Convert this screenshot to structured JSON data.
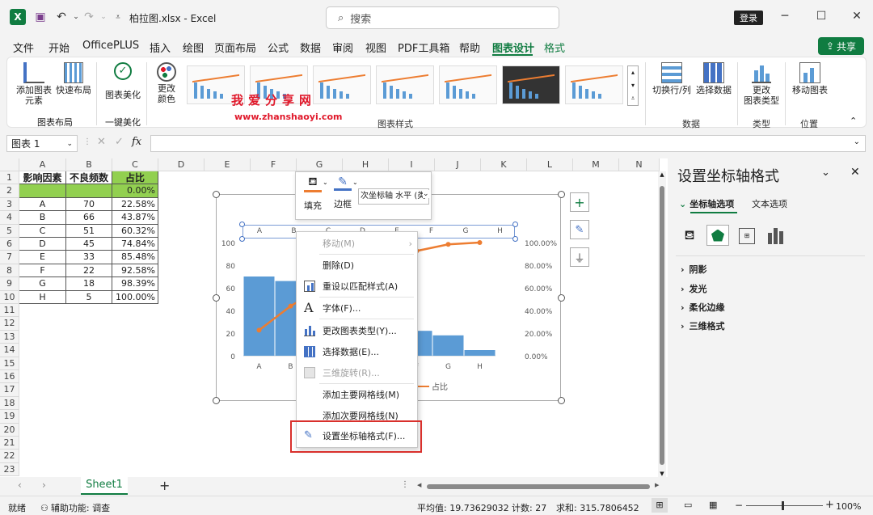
{
  "titlebar": {
    "filename": "柏拉图.xlsx",
    "app": "Excel",
    "search_placeholder": "搜索",
    "login": "登录"
  },
  "menu": {
    "tabs": [
      "文件",
      "开始",
      "OfficePLUS",
      "插入",
      "绘图",
      "页面布局",
      "公式",
      "数据",
      "审阅",
      "视图",
      "PDF工具箱",
      "帮助",
      "图表设计",
      "格式"
    ],
    "active": "图表设计",
    "share": "共享"
  },
  "ribbon": {
    "add_element": "添加图表\n元素",
    "quick_layout": "快速布局",
    "beautify": "图表美化",
    "change_color": "更改\n颜色",
    "group_layout": "图表布局",
    "group_onekey": "一键美化",
    "group_styles": "图表样式",
    "switch_rowcol": "切换行/列",
    "select_data": "选择数据",
    "group_data": "数据",
    "change_type": "更改\n图表类型",
    "group_type": "类型",
    "move_chart": "移动图表",
    "group_position": "位置",
    "watermark1": "我爱分享网",
    "watermark2": "www.zhanshaoyi.com"
  },
  "formula": {
    "namebox": "图表 1",
    "fx": "fx"
  },
  "columns": [
    "A",
    "B",
    "C",
    "D",
    "E",
    "F",
    "G",
    "H",
    "I",
    "J",
    "K",
    "L",
    "M",
    "N"
  ],
  "rows": [
    "1",
    "2",
    "3",
    "4",
    "5",
    "6",
    "7",
    "8",
    "9",
    "10",
    "11",
    "12",
    "13",
    "14",
    "15",
    "16",
    "17",
    "18",
    "19",
    "20",
    "21",
    "22",
    "23"
  ],
  "table": {
    "headers": [
      "影响因素",
      "不良频数",
      "占比"
    ],
    "row2": [
      "",
      "",
      "0.00%"
    ],
    "data": [
      [
        "A",
        "70",
        "22.58%"
      ],
      [
        "B",
        "66",
        "43.87%"
      ],
      [
        "C",
        "51",
        "60.32%"
      ],
      [
        "D",
        "45",
        "74.84%"
      ],
      [
        "E",
        "33",
        "85.48%"
      ],
      [
        "F",
        "22",
        "92.58%"
      ],
      [
        "G",
        "18",
        "98.39%"
      ],
      [
        "H",
        "5",
        "100.00%"
      ]
    ]
  },
  "chart": {
    "y_ticks": [
      "100",
      "80",
      "60",
      "40",
      "20",
      "0"
    ],
    "y2_ticks": [
      "100.00%",
      "80.00%",
      "60.00%",
      "40.00%",
      "20.00%",
      "0.00%"
    ],
    "x_ticks": [
      "A",
      "B",
      "C",
      "D",
      "E",
      "F",
      "G",
      "H"
    ],
    "legend": "占比"
  },
  "chart_data": {
    "type": "bar",
    "categories": [
      "A",
      "B",
      "C",
      "D",
      "E",
      "F",
      "G",
      "H"
    ],
    "series": [
      {
        "name": "不良频数",
        "values": [
          70,
          66,
          51,
          45,
          33,
          22,
          18,
          5
        ]
      },
      {
        "name": "占比",
        "values": [
          22.58,
          43.87,
          60.32,
          74.84,
          85.48,
          92.58,
          98.39,
          100.0
        ]
      }
    ],
    "ylim": [
      0,
      100
    ],
    "y2lim": [
      0,
      100
    ]
  },
  "mini_toolbar": {
    "fill": "填充",
    "border": "边框",
    "dropdown": "次坐标轴 水平 (类"
  },
  "context_menu": {
    "items": [
      "移动(M)",
      "删除(D)",
      "重设以匹配样式(A)",
      "字体(F)...",
      "更改图表类型(Y)...",
      "选择数据(E)...",
      "三维旋转(R)...",
      "添加主要网格线(M)",
      "添加次要网格线(N)",
      "设置坐标轴格式(F)..."
    ]
  },
  "panel": {
    "title": "设置坐标轴格式",
    "tab1": "坐标轴选项",
    "tab2": "文本选项",
    "sections": [
      "阴影",
      "发光",
      "柔化边缘",
      "三维格式"
    ]
  },
  "sheet": {
    "name": "Sheet1"
  },
  "status": {
    "ready": "就绪",
    "accessibility": "辅助功能: 调查",
    "average": "平均值: 19.73629032",
    "count": "计数: 27",
    "sum": "求和: 315.7806452",
    "zoom": "100%"
  }
}
